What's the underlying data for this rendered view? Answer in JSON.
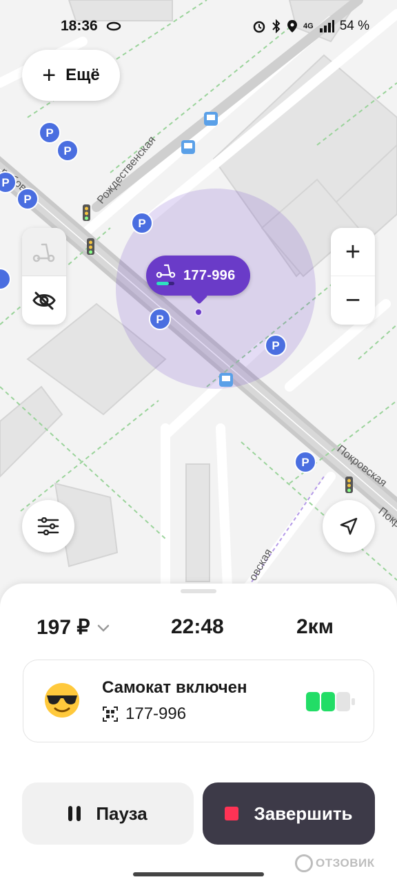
{
  "status_bar": {
    "time": "18:36",
    "battery_percent": "54 %",
    "network": "4G"
  },
  "map": {
    "more_button_label": "Ещё",
    "streets": [
      "Рождественская",
      "Покровская",
      "Покровская",
      "Покр",
      "овская",
      "рубова"
    ],
    "scooter_pin": {
      "number": "177-996"
    },
    "zoom_in_label": "+",
    "zoom_out_label": "−"
  },
  "ride": {
    "price": "197 ₽",
    "duration": "22:48",
    "distance": "2км"
  },
  "scooter_card": {
    "status": "Самокат включен",
    "number": "177-996",
    "battery_level": 0.66,
    "battery_color": "#22dd66"
  },
  "actions": {
    "pause_label": "Пауза",
    "finish_label": "Завершить"
  },
  "watermark": "ОТЗОВИК",
  "colors": {
    "accent": "#6a3bc8",
    "finish_button": "#3d3a48",
    "stop_icon": "#ff3355"
  }
}
